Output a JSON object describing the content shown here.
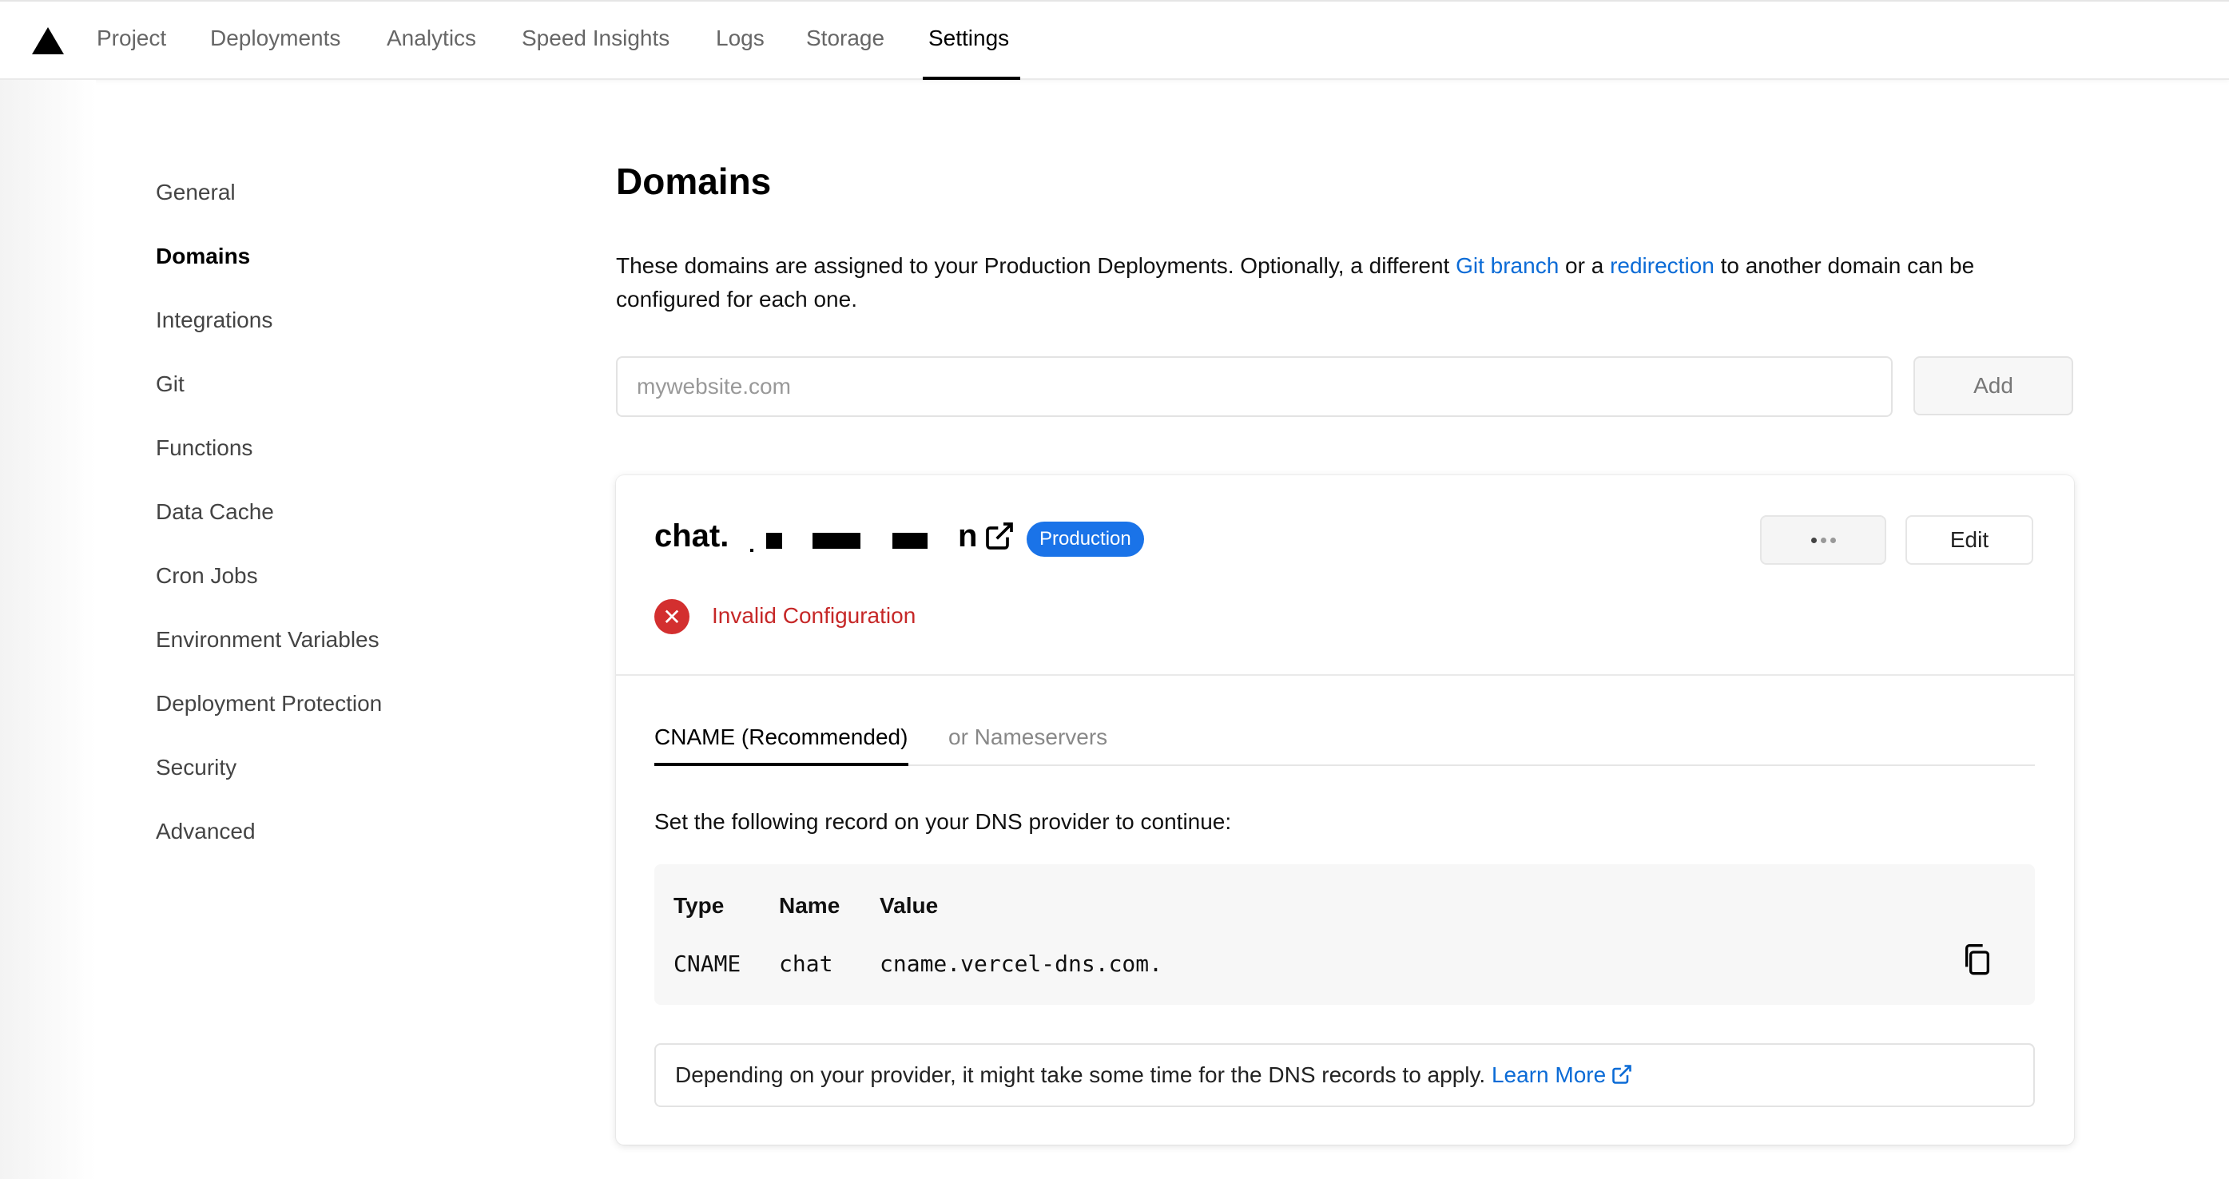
{
  "nav": {
    "tabs": [
      {
        "label": "Project"
      },
      {
        "label": "Deployments"
      },
      {
        "label": "Analytics"
      },
      {
        "label": "Speed Insights"
      },
      {
        "label": "Logs"
      },
      {
        "label": "Storage"
      },
      {
        "label": "Settings",
        "active": true
      }
    ]
  },
  "sidebar": {
    "items": [
      {
        "label": "General"
      },
      {
        "label": "Domains",
        "active": true
      },
      {
        "label": "Integrations"
      },
      {
        "label": "Git"
      },
      {
        "label": "Functions"
      },
      {
        "label": "Data Cache"
      },
      {
        "label": "Cron Jobs"
      },
      {
        "label": "Environment Variables"
      },
      {
        "label": "Deployment Protection"
      },
      {
        "label": "Security"
      },
      {
        "label": "Advanced"
      }
    ]
  },
  "main": {
    "title": "Domains",
    "description": {
      "part1": "These domains are assigned to your Production Deployments. Optionally, a different ",
      "link1": "Git branch",
      "part2": " or a ",
      "link2": "redirection",
      "part3": " to another domain can be configured for each one."
    },
    "input": {
      "placeholder": "mywebsite.com",
      "value": ""
    },
    "add_label": "Add"
  },
  "domain_card": {
    "domain_prefix": "chat.",
    "domain_suffix_visible": "n",
    "badge": "Production",
    "edit_label": "Edit",
    "status": "Invalid Configuration",
    "tabs": {
      "active": "CNAME (Recommended)",
      "inactive": "or Nameservers"
    },
    "instruction": "Set the following record on your DNS provider to continue:",
    "record": {
      "headers": {
        "type": "Type",
        "name": "Name",
        "value": "Value"
      },
      "type": "CNAME",
      "name": "chat",
      "value": "cname.vercel-dns.com."
    },
    "note": {
      "text": "Depending on your provider, it might take some time for the DNS records to apply. ",
      "link": "Learn More"
    }
  },
  "colors": {
    "accent": "#0b6bd6",
    "badge": "#1a73e8",
    "error": "#c62828"
  },
  "icons": [
    "vercel-logo",
    "external-link-icon",
    "more-icon",
    "error-x-icon",
    "copy-icon"
  ]
}
